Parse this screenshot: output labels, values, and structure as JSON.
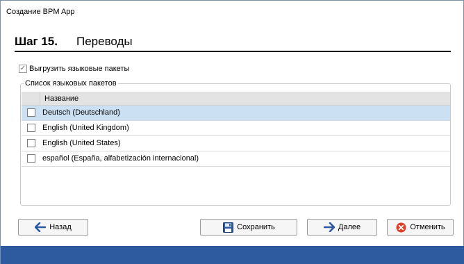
{
  "window": {
    "title": "Создание BPM App"
  },
  "step": {
    "number": "Шаг 15.",
    "title": "Переводы"
  },
  "export": {
    "label": "Выгрузить языковые пакеты",
    "checked": true
  },
  "packages": {
    "legend": "Список языковых пакетов",
    "column_name": "Название",
    "items": [
      {
        "label": "Deutsch (Deutschland)",
        "checked": false,
        "selected": true
      },
      {
        "label": "English (United Kingdom)",
        "checked": false,
        "selected": false
      },
      {
        "label": "English (United States)",
        "checked": false,
        "selected": false
      },
      {
        "label": "español (España, alfabetización internacional)",
        "checked": false,
        "selected": false
      }
    ]
  },
  "buttons": {
    "back": "Назад",
    "save": "Сохранить",
    "next": "Далее",
    "cancel": "Отменить"
  },
  "colors": {
    "accent": "#2e5aa0",
    "selection": "#cce0f4",
    "cancel_icon": "#e0402a"
  }
}
